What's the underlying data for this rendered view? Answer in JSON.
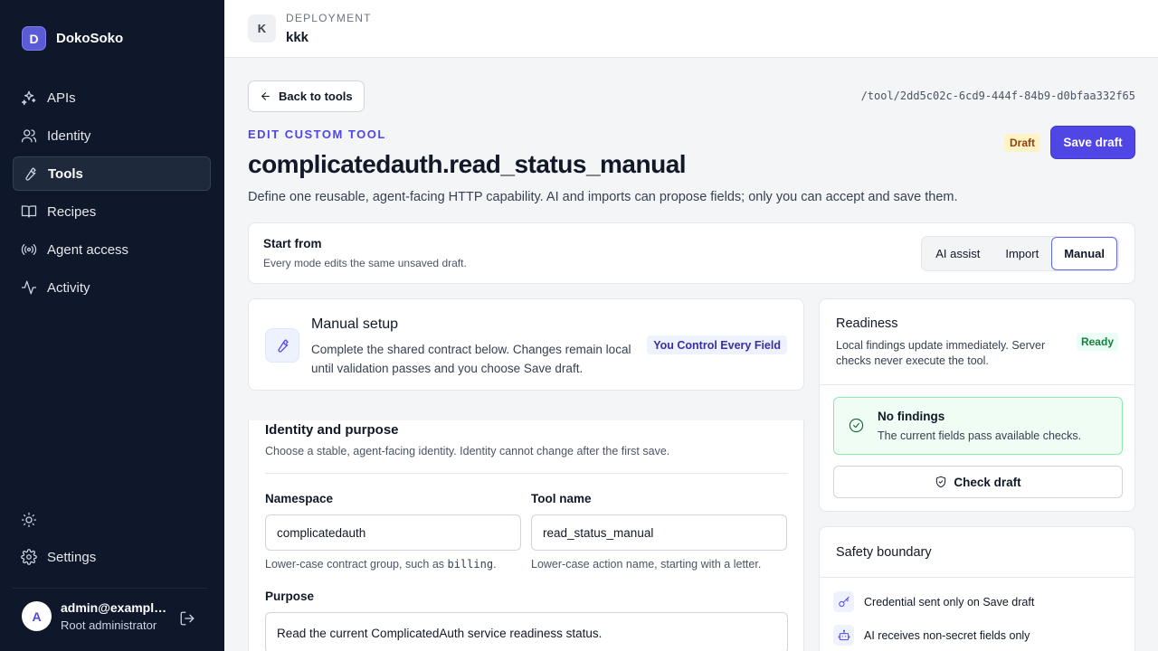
{
  "brand": {
    "initial": "D",
    "name": "DokoSoko"
  },
  "nav": [
    {
      "label": "APIs",
      "icon": "sparkles-icon"
    },
    {
      "label": "Identity",
      "icon": "users-icon"
    },
    {
      "label": "Tools",
      "icon": "wrench-icon",
      "active": true
    },
    {
      "label": "Recipes",
      "icon": "book-icon"
    },
    {
      "label": "Agent access",
      "icon": "broadcast-icon"
    },
    {
      "label": "Activity",
      "icon": "activity-icon"
    }
  ],
  "settings_label": "Settings",
  "user": {
    "initial": "A",
    "email": "admin@example...",
    "role": "Root administrator"
  },
  "deployment": {
    "initial": "K",
    "label": "DEPLOYMENT",
    "name": "kkk"
  },
  "back_label": "Back to tools",
  "tool_path": "/tool/2dd5c02c-6cd9-444f-84b9-d0bfaa332f65",
  "eyebrow": "EDIT CUSTOM TOOL",
  "title": "complicatedauth.read_status_manual",
  "description": "Define one reusable, agent-facing HTTP capability. AI and imports can propose fields; only you can accept and save them.",
  "status_badge": "Draft",
  "save_label": "Save draft",
  "start": {
    "title": "Start from",
    "subtitle": "Every mode edits the same unsaved draft.",
    "modes": [
      "AI assist",
      "Import",
      "Manual"
    ],
    "selected": "Manual"
  },
  "manual": {
    "title": "Manual setup",
    "description": "Complete the shared contract below. Changes remain local until validation passes and you choose Save draft.",
    "badge": "You Control Every Field"
  },
  "identity": {
    "title": "Identity and purpose",
    "subtitle": "Choose a stable, agent-facing identity. Identity cannot change after the first save.",
    "namespace_label": "Namespace",
    "namespace_value": "complicatedauth",
    "namespace_hint_prefix": "Lower-case contract group, such as ",
    "namespace_hint_code": "billing",
    "namespace_hint_suffix": ".",
    "toolname_label": "Tool name",
    "toolname_value": "read_status_manual",
    "toolname_hint": "Lower-case action name, starting with a letter.",
    "purpose_label": "Purpose",
    "purpose_value": "Read the current ComplicatedAuth service readiness status."
  },
  "readiness": {
    "title": "Readiness",
    "description": "Local findings update immediately. Server checks never execute the tool.",
    "badge": "Ready",
    "findings_title": "No findings",
    "findings_sub": "The current fields pass available checks.",
    "check_label": "Check draft"
  },
  "safety": {
    "title": "Safety boundary",
    "items": [
      {
        "label": "Credential sent only on Save draft",
        "icon": "key-icon"
      },
      {
        "label": "AI receives non-secret fields only",
        "icon": "robot-icon"
      }
    ]
  },
  "colors": {
    "accent": "#4f46e5",
    "sidebar": "#0f172a",
    "ready": "#15803d",
    "draft": "#92400e"
  }
}
